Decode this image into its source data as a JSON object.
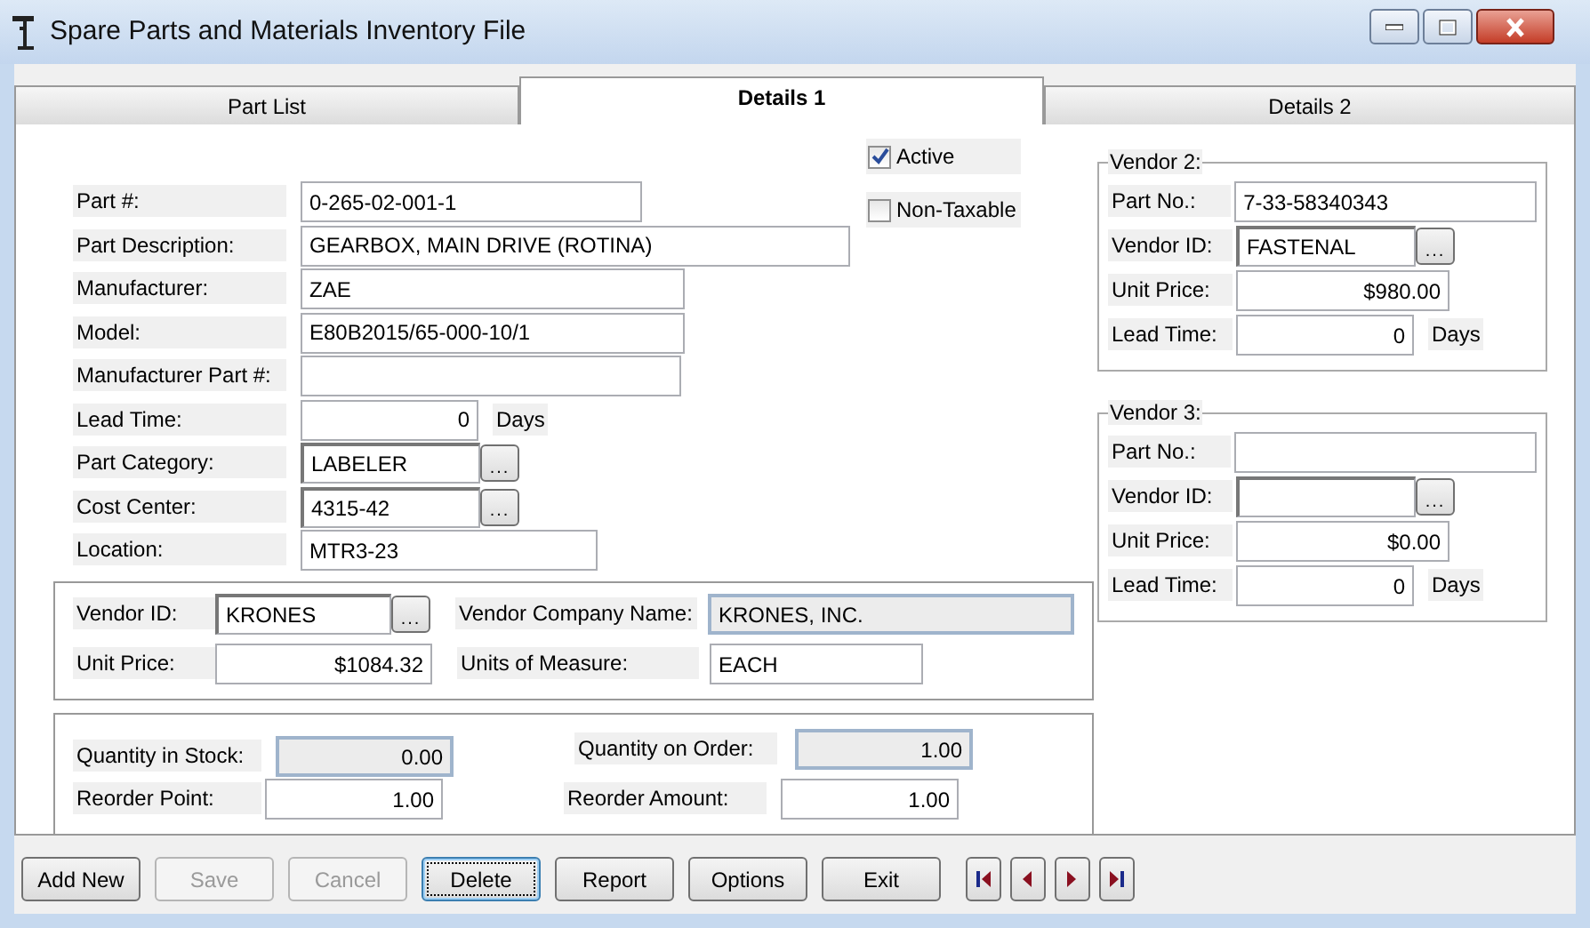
{
  "window": {
    "title": "Spare Parts and Materials Inventory File"
  },
  "tabs": [
    {
      "label": "Part List",
      "selected": false
    },
    {
      "label": "Details 1",
      "selected": true
    },
    {
      "label": "Details 2",
      "selected": false
    }
  ],
  "flags": [
    {
      "label": "Active",
      "checked": true
    },
    {
      "label": "Non-Taxable",
      "checked": false
    }
  ],
  "fields": [
    {
      "kind": "text",
      "label": "Part #:",
      "value": "0-265-02-001-1"
    },
    {
      "kind": "text",
      "label": "Part Description:",
      "value": "GEARBOX, MAIN DRIVE (ROTINA)"
    },
    {
      "kind": "text",
      "label": "Manufacturer:",
      "value": "ZAE"
    },
    {
      "kind": "text",
      "label": "Model:",
      "value": "E80B2015/65-000-10/1"
    },
    {
      "kind": "text",
      "label": "Manufacturer Part #:"
    },
    {
      "kind": "number",
      "label": "Lead Time:",
      "value": "0",
      "suffix": "Days"
    },
    {
      "kind": "lookup",
      "label": "Part Category:",
      "value": "LABELER",
      "button": "..."
    },
    {
      "kind": "lookup",
      "label": "Cost Center:",
      "value": "4315-42",
      "button": "..."
    },
    {
      "kind": "text",
      "label": "Location:",
      "value": "MTR3-23"
    }
  ],
  "vendor": {
    "vendor_id": {
      "label": "Vendor ID:",
      "value": "KRONES",
      "button": "..."
    },
    "company_name": {
      "label": "Vendor Company Name:",
      "value": "KRONES, INC."
    },
    "unit_price": {
      "label": "Unit Price:",
      "value": "$1084.32"
    },
    "units_of_measure": {
      "label": "Units of Measure:",
      "value": "EACH"
    }
  },
  "quantities": {
    "in_stock": {
      "label": "Quantity in Stock:",
      "value": "0.00"
    },
    "on_order": {
      "label": "Quantity on Order:",
      "value": "1.00"
    },
    "reorder_point": {
      "label": "Reorder Point:",
      "value": "1.00"
    },
    "reorder_amount": {
      "label": "Reorder Amount:",
      "value": "1.00"
    }
  },
  "alt_vendors": [
    {
      "title": "Vendor 2:",
      "part_no": {
        "label": "Part No.:",
        "value": "7-33-58340343"
      },
      "vendor_id": {
        "label": "Vendor ID:",
        "value": "FASTENAL",
        "button": "..."
      },
      "unit_price": {
        "label": "Unit Price:",
        "value": "$980.00"
      },
      "lead_time": {
        "label": "Lead Time:",
        "value": "0",
        "suffix": "Days"
      }
    },
    {
      "title": "Vendor 3:",
      "part_no": {
        "label": "Part No.:"
      },
      "vendor_id": {
        "label": "Vendor ID:",
        "button": "..."
      },
      "unit_price": {
        "label": "Unit Price:",
        "value": "$0.00"
      },
      "lead_time": {
        "label": "Lead Time:",
        "value": "0",
        "suffix": "Days"
      }
    }
  ],
  "buttons": [
    {
      "label": "Add New",
      "disabled": false,
      "focused": false
    },
    {
      "label": "Save",
      "disabled": true,
      "focused": false
    },
    {
      "label": "Cancel",
      "disabled": true,
      "focused": false
    },
    {
      "label": "Delete",
      "disabled": false,
      "focused": true
    },
    {
      "label": "Report",
      "disabled": false,
      "focused": false
    },
    {
      "label": "Options",
      "disabled": false,
      "focused": false
    },
    {
      "label": "Exit",
      "disabled": false,
      "focused": false
    }
  ],
  "nav_buttons": [
    {
      "kind": "first"
    },
    {
      "kind": "previous"
    },
    {
      "kind": "next"
    },
    {
      "kind": "last"
    }
  ]
}
